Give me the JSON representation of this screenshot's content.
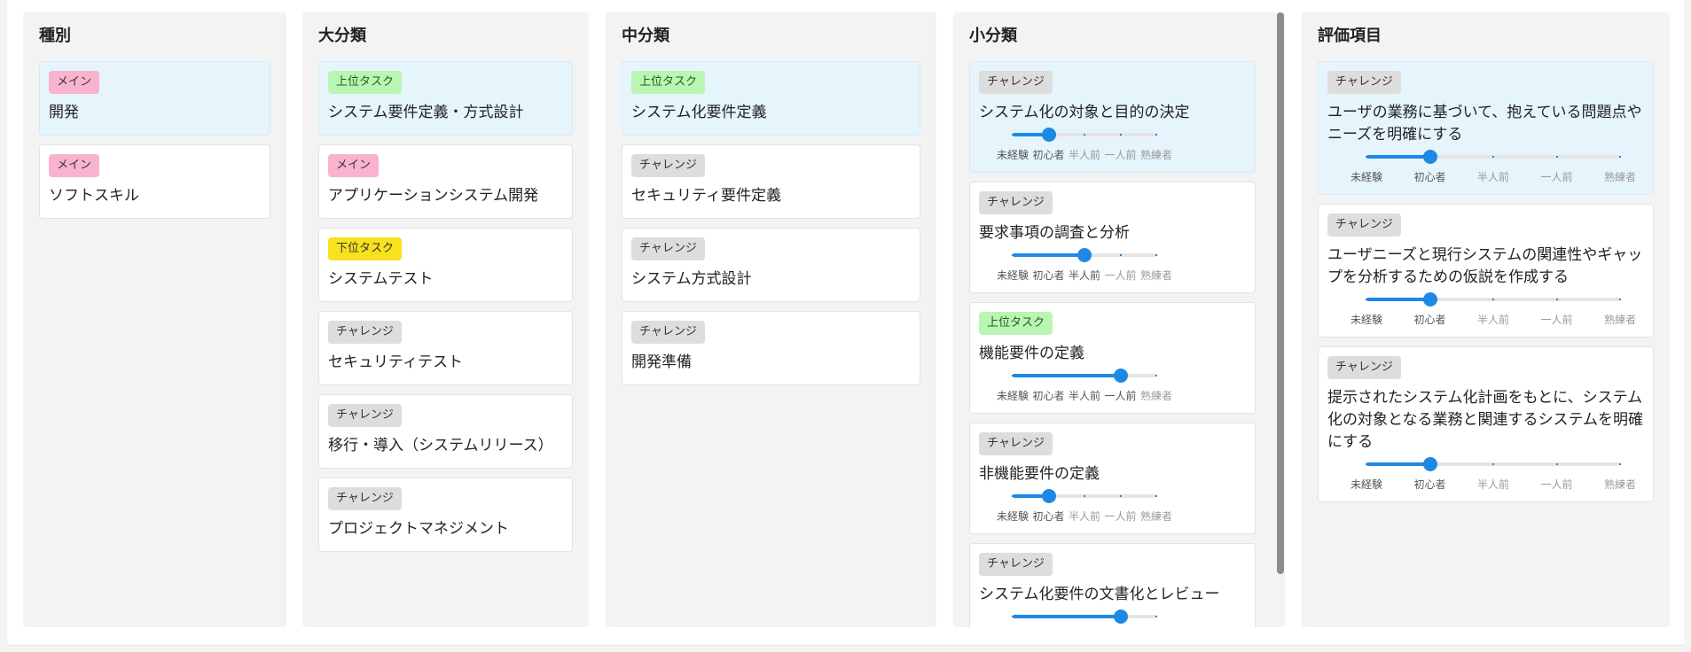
{
  "level_labels": [
    "未経験",
    "初心者",
    "半人前",
    "一人前",
    "熟練者"
  ],
  "columns": [
    {
      "title": "種別",
      "cards": [
        {
          "tag": "メイン",
          "tag_type": "main",
          "label": "開発",
          "selected": true
        },
        {
          "tag": "メイン",
          "tag_type": "main",
          "label": "ソフトスキル",
          "selected": false
        }
      ]
    },
    {
      "title": "大分類",
      "cards": [
        {
          "tag": "上位タスク",
          "tag_type": "up",
          "label": "システム要件定義・方式設計",
          "selected": true
        },
        {
          "tag": "メイン",
          "tag_type": "main",
          "label": "アプリケーションシステム開発",
          "selected": false
        },
        {
          "tag": "下位タスク",
          "tag_type": "down",
          "label": "システムテスト",
          "selected": false
        },
        {
          "tag": "チャレンジ",
          "tag_type": "ch",
          "label": "セキュリティテスト",
          "selected": false
        },
        {
          "tag": "チャレンジ",
          "tag_type": "ch",
          "label": "移行・導入（システムリリース）",
          "selected": false
        },
        {
          "tag": "チャレンジ",
          "tag_type": "ch",
          "label": "プロジェクトマネジメント",
          "selected": false
        }
      ]
    },
    {
      "title": "中分類",
      "cards": [
        {
          "tag": "上位タスク",
          "tag_type": "up",
          "label": "システム化要件定義",
          "selected": true
        },
        {
          "tag": "チャレンジ",
          "tag_type": "ch",
          "label": "セキュリティ要件定義",
          "selected": false
        },
        {
          "tag": "チャレンジ",
          "tag_type": "ch",
          "label": "システム方式設計",
          "selected": false
        },
        {
          "tag": "チャレンジ",
          "tag_type": "ch",
          "label": "開発準備",
          "selected": false
        }
      ]
    },
    {
      "title": "小分類",
      "cards": [
        {
          "tag": "チャレンジ",
          "tag_type": "ch",
          "label": "システム化の対象と目的の決定",
          "selected": true,
          "level": 1
        },
        {
          "tag": "チャレンジ",
          "tag_type": "ch",
          "label": "要求事項の調査と分析",
          "selected": false,
          "level": 2
        },
        {
          "tag": "上位タスク",
          "tag_type": "up",
          "label": "機能要件の定義",
          "selected": false,
          "level": 3
        },
        {
          "tag": "チャレンジ",
          "tag_type": "ch",
          "label": "非機能要件の定義",
          "selected": false,
          "level": 1
        },
        {
          "tag": "チャレンジ",
          "tag_type": "ch",
          "label": "システム化要件の文書化とレビュー",
          "selected": false,
          "level": 3
        }
      ]
    },
    {
      "title": "評価項目",
      "cards": [
        {
          "tag": "チャレンジ",
          "tag_type": "ch",
          "label": "ユーザの業務に基づいて、抱えている問題点やニーズを明確にする",
          "selected": true,
          "level": 1
        },
        {
          "tag": "チャレンジ",
          "tag_type": "ch",
          "label": "ユーザニーズと現行システムの関連性やギャップを分析するための仮説を作成する",
          "selected": false,
          "level": 1
        },
        {
          "tag": "チャレンジ",
          "tag_type": "ch",
          "label": "提示されたシステム化計画をもとに、システム化の対象となる業務と関連するシステムを明確にする",
          "selected": false,
          "level": 1
        }
      ]
    }
  ]
}
